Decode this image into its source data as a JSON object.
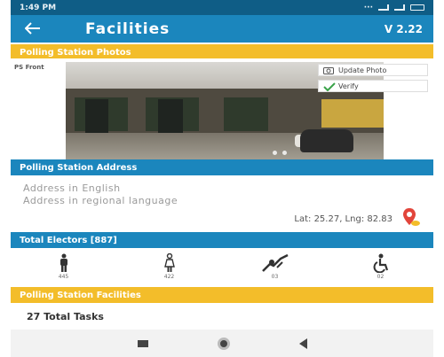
{
  "status_bar": {
    "time": "1:49 PM"
  },
  "app_bar": {
    "title": "Facilities",
    "version": "V 2.22"
  },
  "photo_section": {
    "header": "Polling Station Photos",
    "caption": "PS Front",
    "update_photo_label": "Update Photo",
    "verify_label": "Verify"
  },
  "address_section": {
    "header": "Polling Station Address",
    "address_english": "Address in English",
    "address_regional": "Address in regional language",
    "latlng": "Lat: 25.27, Lng: 82.83"
  },
  "electors_section": {
    "header": "Total Electors [887]",
    "items": [
      {
        "icon": "male-icon",
        "count": "445"
      },
      {
        "icon": "female-icon",
        "count": "422"
      },
      {
        "icon": "third-gender-icon",
        "count": "03"
      },
      {
        "icon": "wheelchair-icon",
        "count": "02"
      }
    ]
  },
  "facilities_section": {
    "header": "Polling Station Facilities",
    "tasks": "27 Total Tasks"
  },
  "colors": {
    "primary": "#1b86bd",
    "status": "#0f5d86",
    "accent": "#f3bd2a",
    "pin": "#e2453b"
  }
}
